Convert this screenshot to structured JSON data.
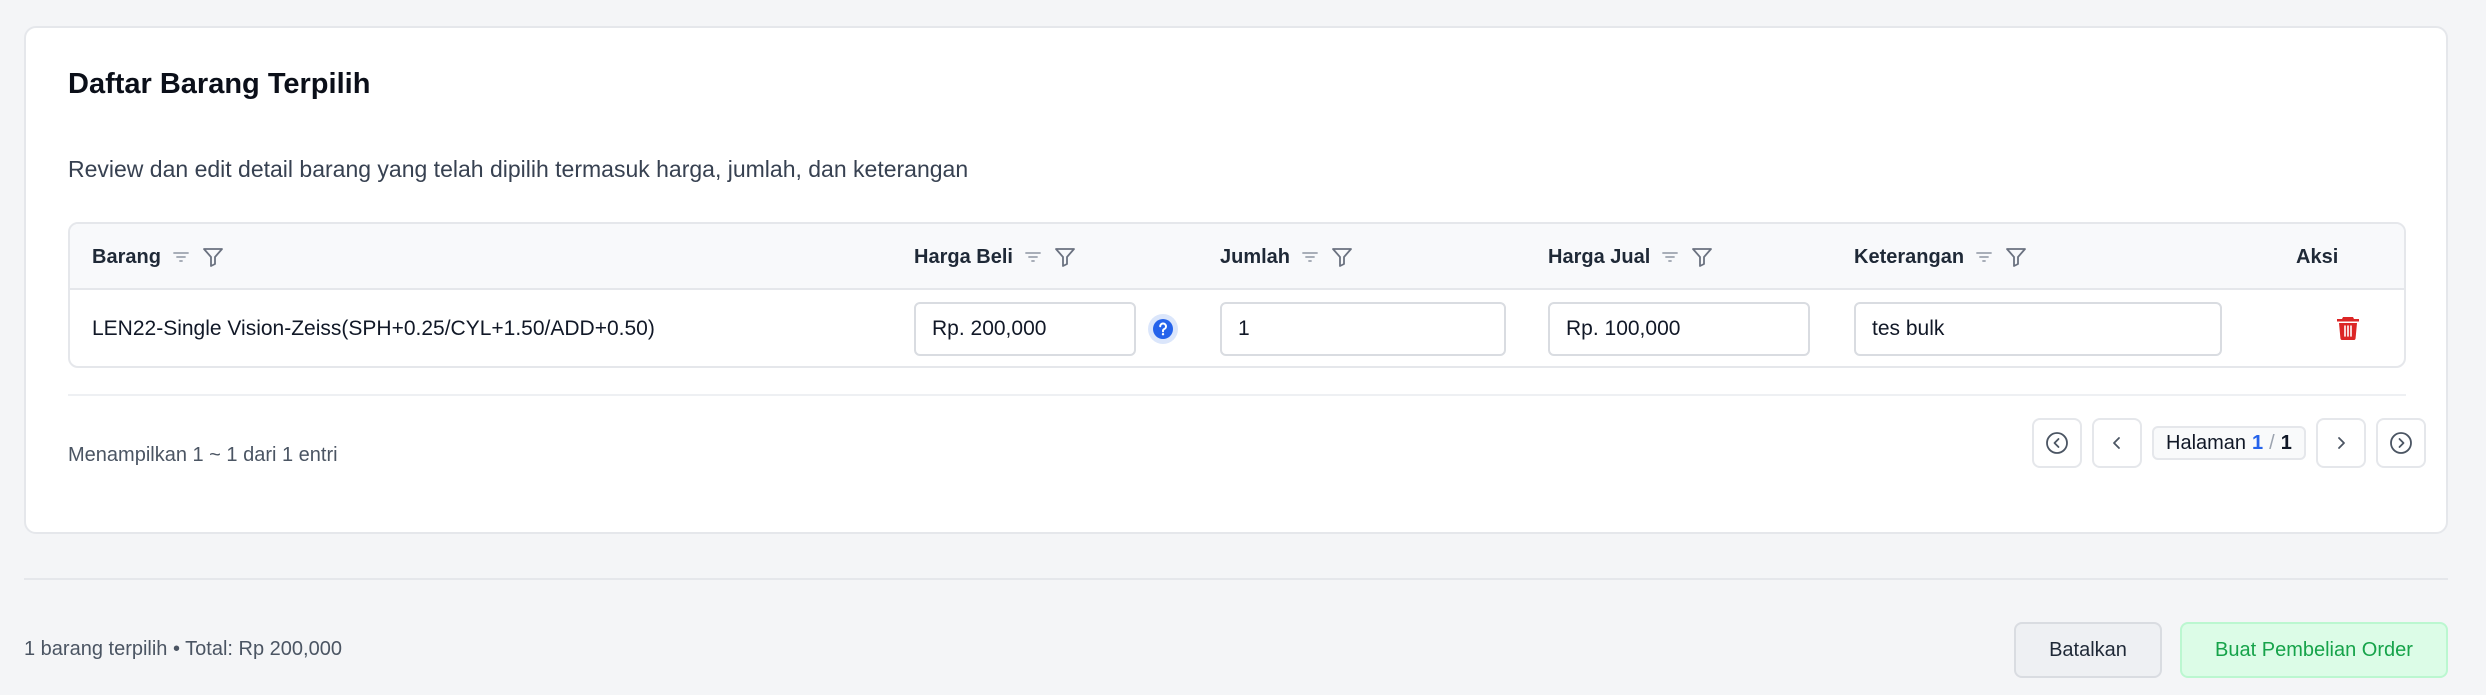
{
  "card": {
    "title": "Daftar Barang Terpilih",
    "description": "Review dan edit detail barang yang telah dipilih termasuk harga, jumlah, dan keterangan"
  },
  "table": {
    "columns": [
      "Barang",
      "Harga Beli",
      "Jumlah",
      "Harga Jual",
      "Keterangan",
      "Aksi"
    ],
    "rows": [
      {
        "barang": "LEN22-Single Vision-Zeiss(SPH+0.25/CYL+1.50/ADD+0.50)",
        "harga_beli": "Rp. 200,000",
        "jumlah": "1",
        "harga_jual": "Rp. 100,000",
        "keterangan": "tes bulk"
      }
    ]
  },
  "pagination": {
    "showing_text": "Menampilkan 1 ~ 1 dari 1 entri",
    "page_label": "Halaman",
    "current_page": "1",
    "separator": "/",
    "total_pages": "1"
  },
  "footer": {
    "summary": "1 barang terpilih • Total: Rp 200,000",
    "cancel_label": "Batalkan",
    "submit_label": "Buat Pembelian Order"
  },
  "colors": {
    "accent": "#2563eb",
    "danger": "#dc2626",
    "success_text": "#16a34a",
    "success_bg": "#dcfce7"
  },
  "icons": [
    "sort-icon",
    "filter-icon",
    "help-icon",
    "trash-icon",
    "first-page-icon",
    "prev-page-icon",
    "next-page-icon",
    "last-page-icon"
  ]
}
